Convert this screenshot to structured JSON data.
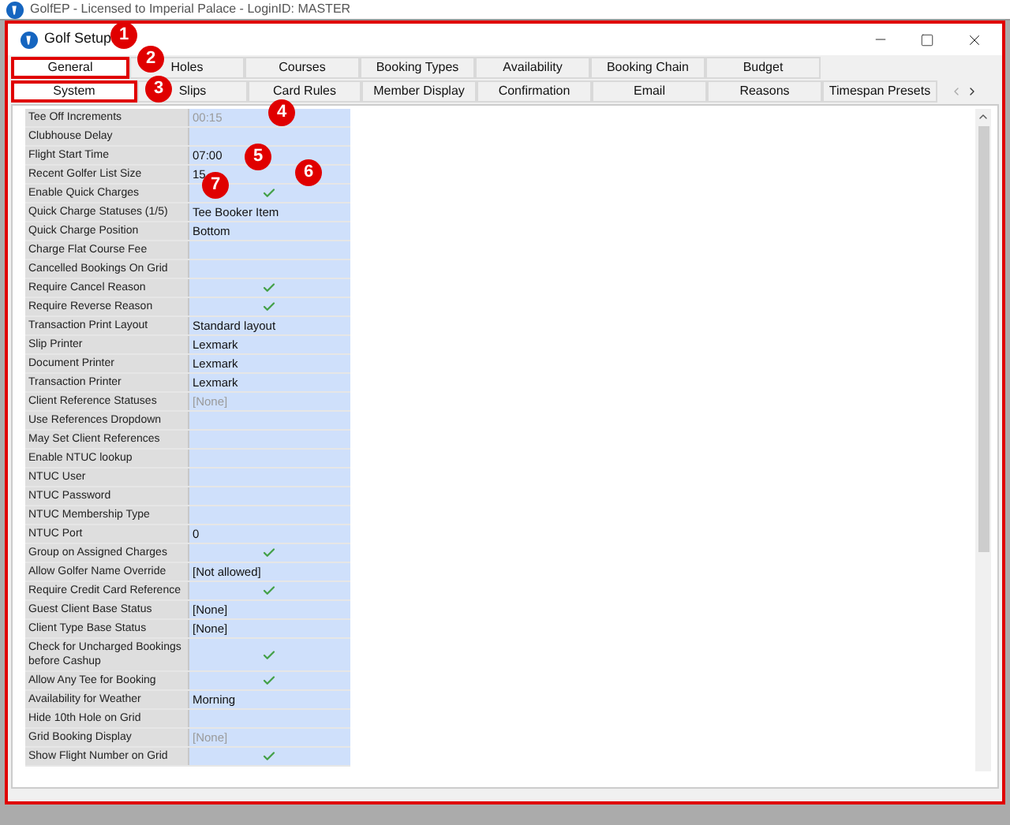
{
  "app_window": {
    "title": "GolfEP - Licensed to Imperial Palace - LoginID: MASTER"
  },
  "window": {
    "title": "Golf Setup"
  },
  "tabs_row_1": [
    {
      "label": "General",
      "selected": true,
      "highlighted": true
    },
    {
      "label": "Holes",
      "selected": false,
      "highlighted": false
    },
    {
      "label": "Courses",
      "selected": false,
      "highlighted": false
    },
    {
      "label": "Booking Types",
      "selected": false,
      "highlighted": false
    },
    {
      "label": "Availability",
      "selected": false,
      "highlighted": false
    },
    {
      "label": "Booking Chain",
      "selected": false,
      "highlighted": false
    },
    {
      "label": "Budget",
      "selected": false,
      "highlighted": false
    }
  ],
  "tabs_row_2": [
    {
      "label": "System",
      "selected": true,
      "highlighted": true
    },
    {
      "label": "Slips",
      "selected": false,
      "highlighted": false
    },
    {
      "label": "Card Rules",
      "selected": false,
      "highlighted": false
    },
    {
      "label": "Member Display",
      "selected": false,
      "highlighted": false
    },
    {
      "label": "Confirmation",
      "selected": false,
      "highlighted": false
    },
    {
      "label": "Email",
      "selected": false,
      "highlighted": false
    },
    {
      "label": "Reasons",
      "selected": false,
      "highlighted": false
    },
    {
      "label": "Timespan Presets",
      "selected": false,
      "highlighted": false
    }
  ],
  "properties": [
    {
      "label": "Tee Off Increments",
      "kind": "text",
      "value": "00:15",
      "disabled": true
    },
    {
      "label": "Clubhouse Delay",
      "kind": "text"
    },
    {
      "label": "Flight Start Time",
      "kind": "text",
      "value": "07:00",
      "disabled": false
    },
    {
      "label": "Recent Golfer List Size",
      "kind": "text",
      "value": "15",
      "disabled": false
    },
    {
      "label": "Enable Quick Charges",
      "kind": "check",
      "checked": true
    },
    {
      "label": "Quick Charge Statuses (1/5)",
      "kind": "text",
      "value": "Tee Booker Item",
      "disabled": false
    },
    {
      "label": "Quick Charge Position",
      "kind": "text",
      "value": "Bottom",
      "disabled": false
    },
    {
      "label": "Charge Flat Course Fee",
      "kind": "text"
    },
    {
      "label": "Cancelled Bookings On Grid",
      "kind": "text"
    },
    {
      "label": "Require Cancel Reason",
      "kind": "check",
      "checked": true
    },
    {
      "label": "Require Reverse Reason",
      "kind": "check",
      "checked": true
    },
    {
      "label": "Transaction Print Layout",
      "kind": "text",
      "value": "Standard layout",
      "disabled": false
    },
    {
      "label": "Slip Printer",
      "kind": "text",
      "value": "Lexmark",
      "disabled": false
    },
    {
      "label": "Document Printer",
      "kind": "text",
      "value": "Lexmark",
      "disabled": false
    },
    {
      "label": "Transaction Printer",
      "kind": "text",
      "value": "Lexmark",
      "disabled": false
    },
    {
      "label": "Client Reference Statuses",
      "kind": "text",
      "value": "[None]",
      "disabled": true
    },
    {
      "label": "Use References Dropdown",
      "kind": "text"
    },
    {
      "label": "May Set Client References",
      "kind": "text"
    },
    {
      "label": "Enable NTUC lookup",
      "kind": "text"
    },
    {
      "label": "NTUC User",
      "kind": "text"
    },
    {
      "label": "NTUC Password",
      "kind": "text"
    },
    {
      "label": "NTUC Membership Type",
      "kind": "text"
    },
    {
      "label": "NTUC Port",
      "kind": "text",
      "value": "0",
      "disabled": false
    },
    {
      "label": "Group on Assigned Charges",
      "kind": "check",
      "checked": true
    },
    {
      "label": "Allow Golfer Name Override",
      "kind": "text",
      "value": "[Not allowed]",
      "disabled": false
    },
    {
      "label": "Require Credit Card Reference",
      "kind": "check",
      "checked": true
    },
    {
      "label": "Guest Client Base Status",
      "kind": "text",
      "value": "[None]",
      "disabled": false
    },
    {
      "label": "Client Type Base Status",
      "kind": "text",
      "value": "[None]",
      "disabled": false
    },
    {
      "label": "Check for Uncharged Bookings before Cashup",
      "kind": "check",
      "checked": true
    },
    {
      "label": "Allow Any Tee for Booking",
      "kind": "check",
      "checked": true
    },
    {
      "label": "Availability for Weather",
      "kind": "text",
      "value": "Morning",
      "disabled": false
    },
    {
      "label": "Hide 10th Hole on Grid",
      "kind": "text"
    },
    {
      "label": "Grid Booking Display",
      "kind": "text",
      "value": "[None]",
      "disabled": true
    },
    {
      "label": "Show Flight Number on Grid",
      "kind": "check",
      "checked": true
    }
  ],
  "annotations": [
    "1",
    "2",
    "3",
    "4",
    "5",
    "6",
    "7"
  ]
}
